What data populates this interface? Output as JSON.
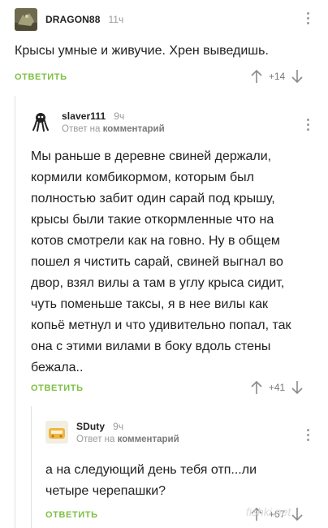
{
  "comments": [
    {
      "username": "DRAGON88",
      "time": "11ч",
      "text": "Крысы умные и живучие. Хрен выведишь.",
      "reply_label": "ОТВЕТИТЬ",
      "rating": "+14"
    },
    {
      "username": "slaver111",
      "time": "9ч",
      "reply_prefix": "Ответ на",
      "reply_target": "комментарий",
      "text_lines": [
        "Мы раньше в деревне свиней держали,",
        "кормили комбикормом, которым был",
        "полностью забит один сарай под крышу,",
        "крысы были такие откормленные что на",
        "котов смотрели как на говно. Ну в общем",
        "пошел я чистить сарай, свиней выгнал во",
        "двор, взял вилы а там в углу крыса сидит,",
        "чуть поменьше таксы, я в нее вилы как",
        "копьё метнул и что удивительно попал, так",
        "она с этими вилами в боку вдоль стены",
        "бежала.."
      ],
      "reply_label": "ОТВЕТИТЬ",
      "rating": "+41"
    },
    {
      "username": "SDuty",
      "time": "9ч",
      "reply_prefix": "Ответ на",
      "reply_target": "комментарий",
      "text_lines": [
        "а на следующий день тебя отп...ли",
        "четыре черепашки?"
      ],
      "reply_label": "ОТВЕТИТЬ",
      "rating": "+67"
    }
  ],
  "watermark": "fishki.net",
  "colors": {
    "accent_green": "#7fbf44",
    "muted": "#9a9a9a",
    "text": "#222222"
  },
  "icons": [
    "avatar-dragon",
    "avatar-octopus",
    "avatar-sduty",
    "more-vertical-icon",
    "arrow-up-icon",
    "arrow-down-icon"
  ]
}
